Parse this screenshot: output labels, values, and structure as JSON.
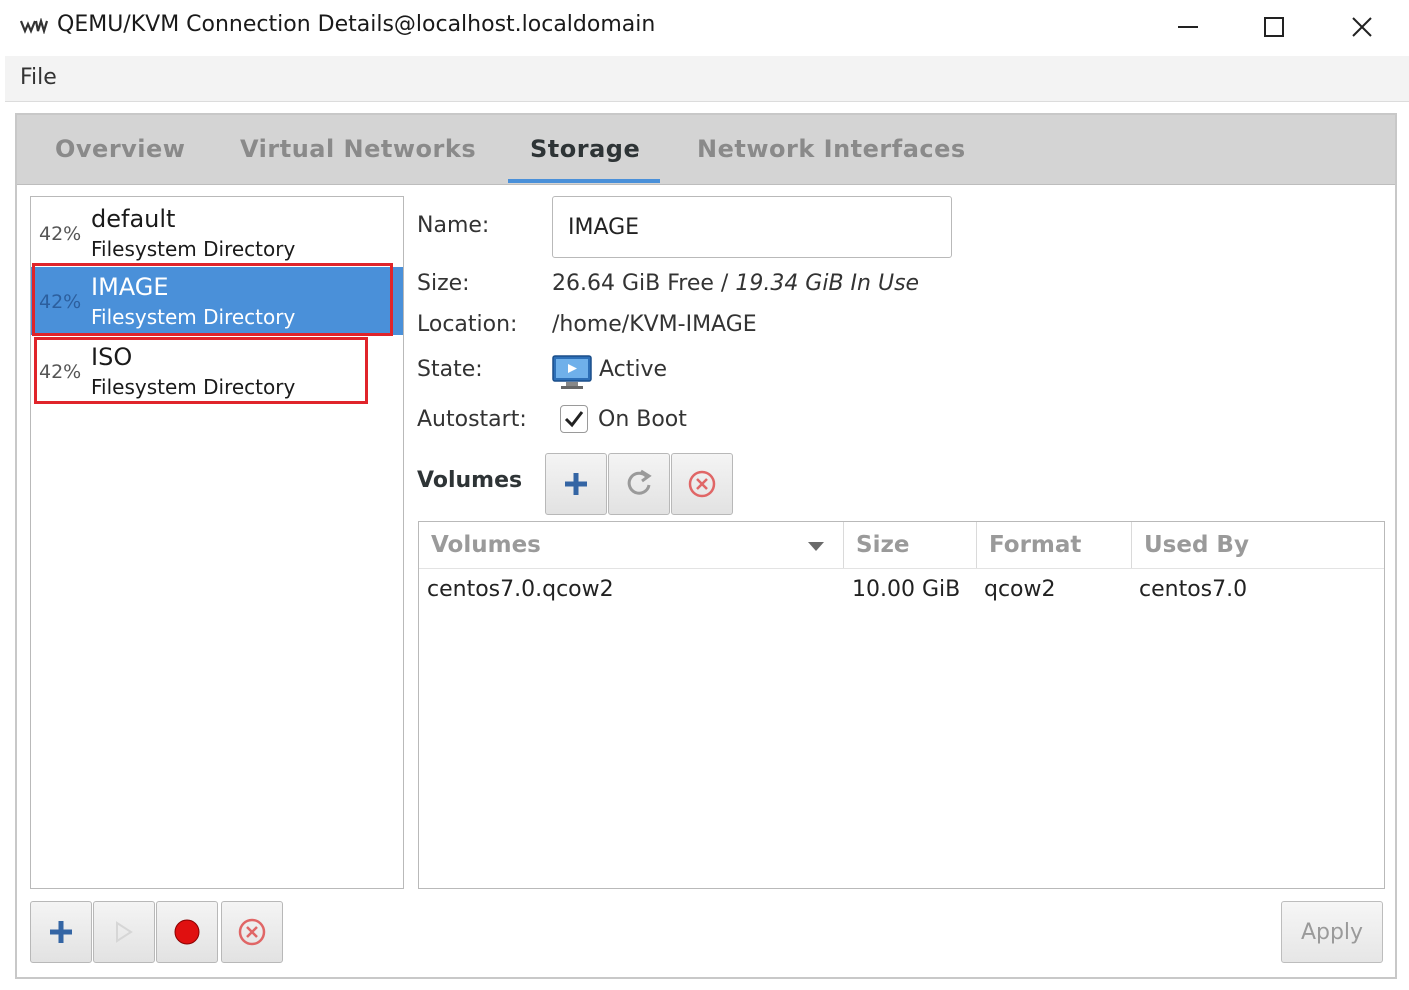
{
  "window": {
    "title": "QEMU/KVM Connection Details@localhost.localdomain",
    "app_icon": "virt-manager-icon",
    "minimize_icon": "minimize-icon",
    "maximize_icon": "maximize-icon",
    "close_icon": "close-icon"
  },
  "menu": {
    "file": "File"
  },
  "tabs": [
    {
      "label": "Overview",
      "active": false
    },
    {
      "label": "Virtual Networks",
      "active": false
    },
    {
      "label": "Storage",
      "active": true
    },
    {
      "label": "Network Interfaces",
      "active": false
    }
  ],
  "pools": [
    {
      "pct": "42%",
      "name": "default",
      "type": "Filesystem Directory",
      "selected": false
    },
    {
      "pct": "42%",
      "name": "IMAGE",
      "type": "Filesystem Directory",
      "selected": true
    },
    {
      "pct": "42%",
      "name": "ISO",
      "type": "Filesystem Directory",
      "selected": false
    }
  ],
  "details": {
    "name_label": "Name:",
    "name_value": "IMAGE",
    "size_label": "Size:",
    "size_free": "26.64 GiB Free",
    "size_sep": "/",
    "size_used": "19.34 GiB In Use",
    "location_label": "Location:",
    "location_value": "/home/KVM-IMAGE",
    "state_label": "State:",
    "state_value": "Active",
    "state_icon": "monitor-active-icon",
    "autostart_label": "Autostart:",
    "autostart_value": "On Boot",
    "autostart_checked": true
  },
  "volumes": {
    "section_label": "Volumes",
    "add_icon": "plus-icon",
    "refresh_icon": "refresh-icon",
    "delete_icon": "delete-icon",
    "columns": [
      "Volumes",
      "Size",
      "Format",
      "Used By"
    ],
    "rows": [
      {
        "name": "centos7.0.qcow2",
        "size": "10.00 GiB",
        "format": "qcow2",
        "used_by": "centos7.0"
      }
    ]
  },
  "pool_toolbar": {
    "add_icon": "plus-icon",
    "start_icon": "play-icon",
    "stop_icon": "stop-record-icon",
    "delete_icon": "delete-icon"
  },
  "apply_label": "Apply",
  "colors": {
    "selection": "#4a90d9",
    "highlight_box": "#e0242a",
    "tab_underline": "#4a90d9"
  }
}
